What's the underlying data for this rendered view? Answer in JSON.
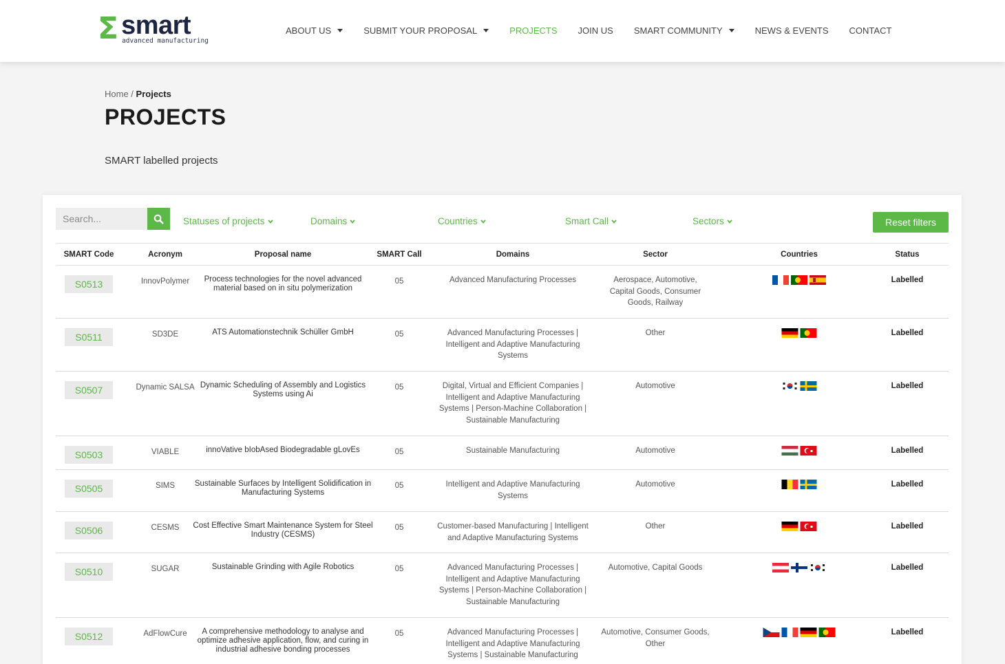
{
  "header": {
    "logo_symbol": "Σ",
    "logo_word": "smart",
    "logo_subtitle": "advanced manufacturing",
    "nav": [
      {
        "label": "ABOUT US",
        "dropdown": true,
        "active": false
      },
      {
        "label": "SUBMIT YOUR PROPOSAL",
        "dropdown": true,
        "active": false
      },
      {
        "label": "PROJECTS",
        "dropdown": false,
        "active": true
      },
      {
        "label": "JOIN US",
        "dropdown": false,
        "active": false
      },
      {
        "label": "SMART COMMUNITY",
        "dropdown": true,
        "active": false
      },
      {
        "label": "NEWS & EVENTS",
        "dropdown": false,
        "active": false
      },
      {
        "label": "CONTACT",
        "dropdown": false,
        "active": false
      }
    ]
  },
  "breadcrumb": {
    "home": "Home",
    "separator": " / ",
    "current": "Projects"
  },
  "page": {
    "title": "PROJECTS",
    "subtitle": "SMART labelled projects"
  },
  "filters": {
    "search_placeholder": "Search...",
    "statuses": "Statuses of projects",
    "domains": "Domains",
    "countries": "Countries",
    "smart_call": "Smart Call",
    "sectors": "Sectors",
    "reset": "Reset filters"
  },
  "table": {
    "columns": [
      "SMART Code",
      "Acronym",
      "Proposal name",
      "SMART Call",
      "Domains",
      "Sector",
      "Countries",
      "Status"
    ],
    "rows": [
      {
        "code": "S0513",
        "acronym": "InnovPolymer",
        "name": "Process technologies for the novel advanced material based on in situ polymerization",
        "call": "05",
        "domains": "Advanced Manufacturing Processes",
        "sector": "Aerospace, Automotive, Capital Goods, Consumer Goods, Railway",
        "countries": [
          "fr",
          "pt",
          "es"
        ],
        "status": "Labelled"
      },
      {
        "code": "S0511",
        "acronym": "SD3DE",
        "name": "ATS Automationstechnik Schüller GmbH",
        "call": "05",
        "domains": "Advanced Manufacturing Processes | Intelligent and Adaptive Manufacturing Systems",
        "sector": "Other",
        "countries": [
          "de",
          "pt"
        ],
        "status": "Labelled"
      },
      {
        "code": "S0507",
        "acronym": "Dynamic SALSA",
        "name": "Dynamic Scheduling of Assembly and Logistics Systems using Ai",
        "call": "05",
        "domains": "Digital, Virtual and Efficient Companies | Intelligent and Adaptive Manufacturing Systems | Person-Machine Collaboration | Sustainable Manufacturing",
        "sector": "Automotive",
        "countries": [
          "kr",
          "se"
        ],
        "status": "Labelled"
      },
      {
        "code": "S0503",
        "acronym": "VIABLE",
        "name": "innoVative bIobAsed Biodegradable gLovEs",
        "call": "05",
        "domains": "Sustainable Manufacturing",
        "sector": "Automotive",
        "countries": [
          "hu",
          "tr"
        ],
        "status": "Labelled"
      },
      {
        "code": "S0505",
        "acronym": "SIMS",
        "name": "Sustainable Surfaces by Intelligent Solidification in Manufacturing Systems",
        "call": "05",
        "domains": "Intelligent and Adaptive Manufacturing Systems",
        "sector": "Automotive",
        "countries": [
          "be",
          "se"
        ],
        "status": "Labelled"
      },
      {
        "code": "S0506",
        "acronym": "CESMS",
        "name": "Cost Effective Smart Maintenance System for Steel Industry (CESMS)",
        "call": "05",
        "domains": "Customer-based Manufacturing | Intelligent and Adaptive Manufacturing Systems",
        "sector": "Other",
        "countries": [
          "de",
          "tr"
        ],
        "status": "Labelled"
      },
      {
        "code": "S0510",
        "acronym": "SUGAR",
        "name": "Sustainable Grinding with Agile Robotics",
        "call": "05",
        "domains": "Advanced Manufacturing Processes | Intelligent and Adaptive Manufacturing Systems | Person-Machine Collaboration | Sustainable Manufacturing",
        "sector": "Automotive, Capital Goods",
        "countries": [
          "at",
          "fi",
          "kr"
        ],
        "status": "Labelled"
      },
      {
        "code": "S0512",
        "acronym": "AdFlowCure",
        "name": "A comprehensive methodology to analyse and optimize adhesive application, flow, and curing in industrial adhesive bonding processes",
        "call": "05",
        "domains": "Advanced Manufacturing Processes | Intelligent and Adaptive Manufacturing Systems | Sustainable Manufacturing",
        "sector": "Automotive, Consumer Goods, Other",
        "countries": [
          "cz",
          "fr",
          "de",
          "pt"
        ],
        "status": "Labelled"
      }
    ]
  },
  "colors": {
    "brand_green": "#5cb847",
    "brand_navy": "#1c2541"
  }
}
